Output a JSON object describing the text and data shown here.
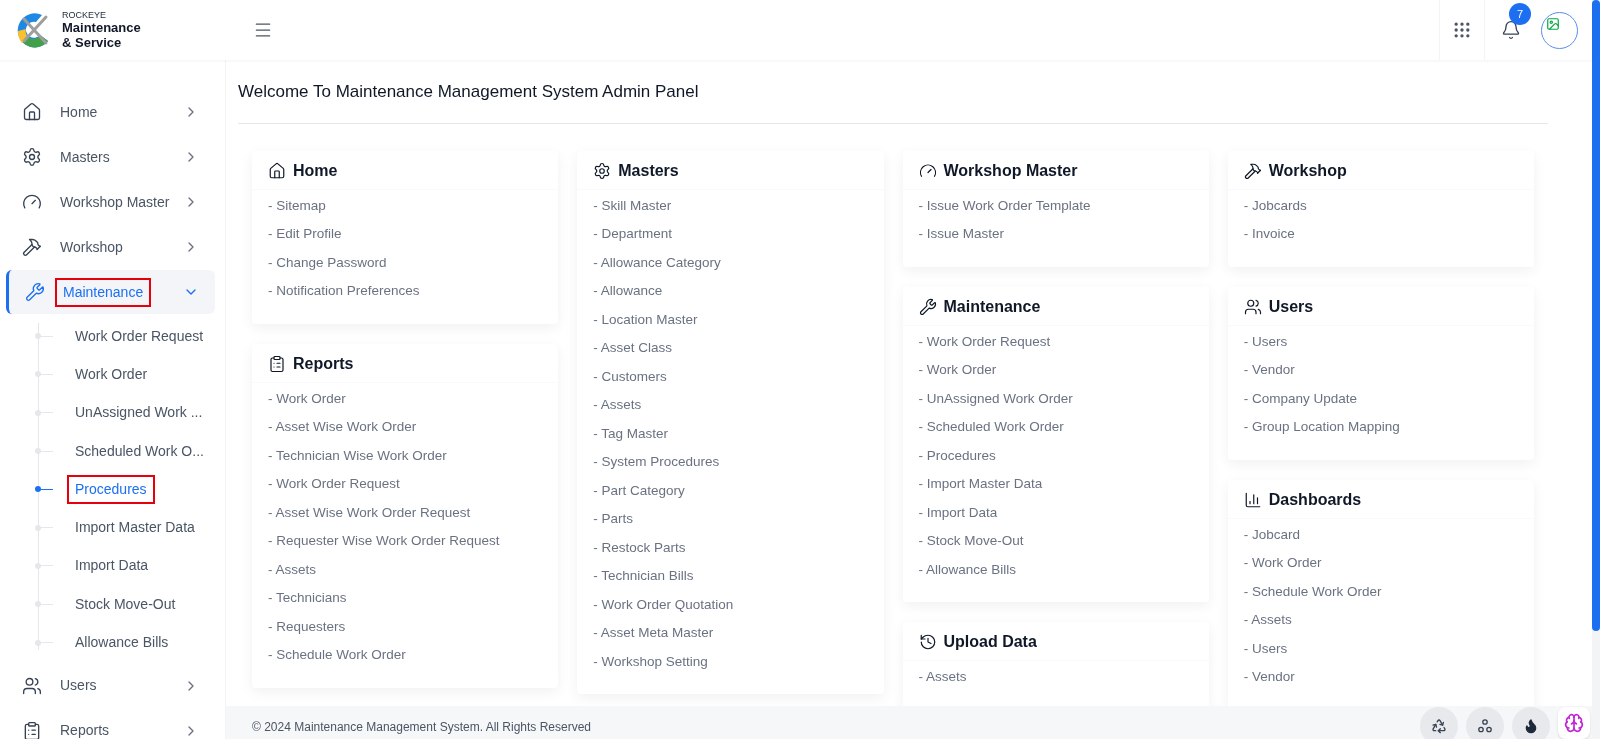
{
  "brand": {
    "tagline": "ROCKEYE",
    "name_line_1": "Maintenance",
    "name_line_2": "& Service"
  },
  "header": {
    "notification_count": "7"
  },
  "sidebar": {
    "items": [
      {
        "label": "Home",
        "kind": "home",
        "selected": false,
        "expanded": false,
        "outlined": false
      },
      {
        "label": "Masters",
        "kind": "gear",
        "selected": false,
        "expanded": false,
        "outlined": false
      },
      {
        "label": "Workshop Master",
        "kind": "gauge",
        "selected": false,
        "expanded": false,
        "outlined": false
      },
      {
        "label": "Workshop",
        "kind": "tools",
        "selected": false,
        "expanded": false,
        "outlined": false
      },
      {
        "label": "Maintenance",
        "kind": "wrench",
        "selected": true,
        "expanded": true,
        "outlined": true,
        "children": [
          {
            "label": "Work Order Request",
            "selected": false,
            "outlined": false
          },
          {
            "label": "Work Order",
            "selected": false,
            "outlined": false
          },
          {
            "label": "UnAssigned Work ...",
            "selected": false,
            "outlined": false
          },
          {
            "label": "Scheduled Work O...",
            "selected": false,
            "outlined": false
          },
          {
            "label": "Procedures",
            "selected": true,
            "outlined": true
          },
          {
            "label": "Import Master Data",
            "selected": false,
            "outlined": false
          },
          {
            "label": "Import Data",
            "selected": false,
            "outlined": false
          },
          {
            "label": "Stock Move-Out",
            "selected": false,
            "outlined": false
          },
          {
            "label": "Allowance Bills",
            "selected": false,
            "outlined": false
          }
        ]
      },
      {
        "label": "Users",
        "kind": "users",
        "selected": false,
        "expanded": false,
        "outlined": false
      },
      {
        "label": "Reports",
        "kind": "clipboard",
        "selected": false,
        "expanded": false,
        "outlined": false
      }
    ]
  },
  "page": {
    "title": "Welcome To Maintenance Management System Admin Panel"
  },
  "columns": [
    [
      {
        "title": "Home",
        "kind": "home",
        "links": [
          "- Sitemap",
          "- Edit Profile",
          "- Change Password",
          "- Notification Preferences"
        ]
      },
      {
        "title": "Reports",
        "kind": "clipboard",
        "links": [
          "- Work Order",
          "- Asset Wise Work Order",
          "- Technician Wise Work Order",
          "- Work Order Request",
          "- Asset Wise Work Order Request",
          "- Requester Wise Work Order Request",
          "- Assets",
          "- Technicians",
          "- Requesters",
          "- Schedule Work Order"
        ]
      }
    ],
    [
      {
        "title": "Masters",
        "kind": "gear",
        "links": [
          "- Skill Master",
          "- Department",
          "- Allowance Category",
          "- Allowance",
          "- Location Master",
          "- Asset Class",
          "- Customers",
          "- Assets",
          "- Tag Master",
          "- System Procedures",
          "- Part Category",
          "- Parts",
          "- Restock Parts",
          "- Technician Bills",
          "- Work Order Quotation",
          "- Asset Meta Master",
          "- Workshop Setting"
        ]
      }
    ],
    [
      {
        "title": "Workshop Master",
        "kind": "gauge",
        "links": [
          "- Issue Work Order Template",
          "- Issue Master"
        ]
      },
      {
        "title": "Maintenance",
        "kind": "wrench",
        "links": [
          "- Work Order Request",
          "- Work Order",
          "- UnAssigned Work Order",
          "- Scheduled Work Order",
          "- Procedures",
          "- Import Master Data",
          "- Import Data",
          "- Stock Move-Out",
          "- Allowance Bills"
        ]
      },
      {
        "title": "Upload Data",
        "kind": "history",
        "links": [
          "- Assets"
        ]
      }
    ],
    [
      {
        "title": "Workshop",
        "kind": "tools",
        "links": [
          "- Jobcards",
          "- Invoice"
        ]
      },
      {
        "title": "Users",
        "kind": "users",
        "links": [
          "- Users",
          "- Vendor",
          "- Company Update",
          "- Group Location Mapping"
        ]
      },
      {
        "title": "Dashboards",
        "kind": "chart",
        "links": [
          "- Jobcard",
          "- Work Order",
          "- Schedule Work Order",
          "- Assets",
          "- Users",
          "- Vendor"
        ]
      }
    ]
  ],
  "footer": "© 2024 Maintenance Management System. All Rights Reserved"
}
